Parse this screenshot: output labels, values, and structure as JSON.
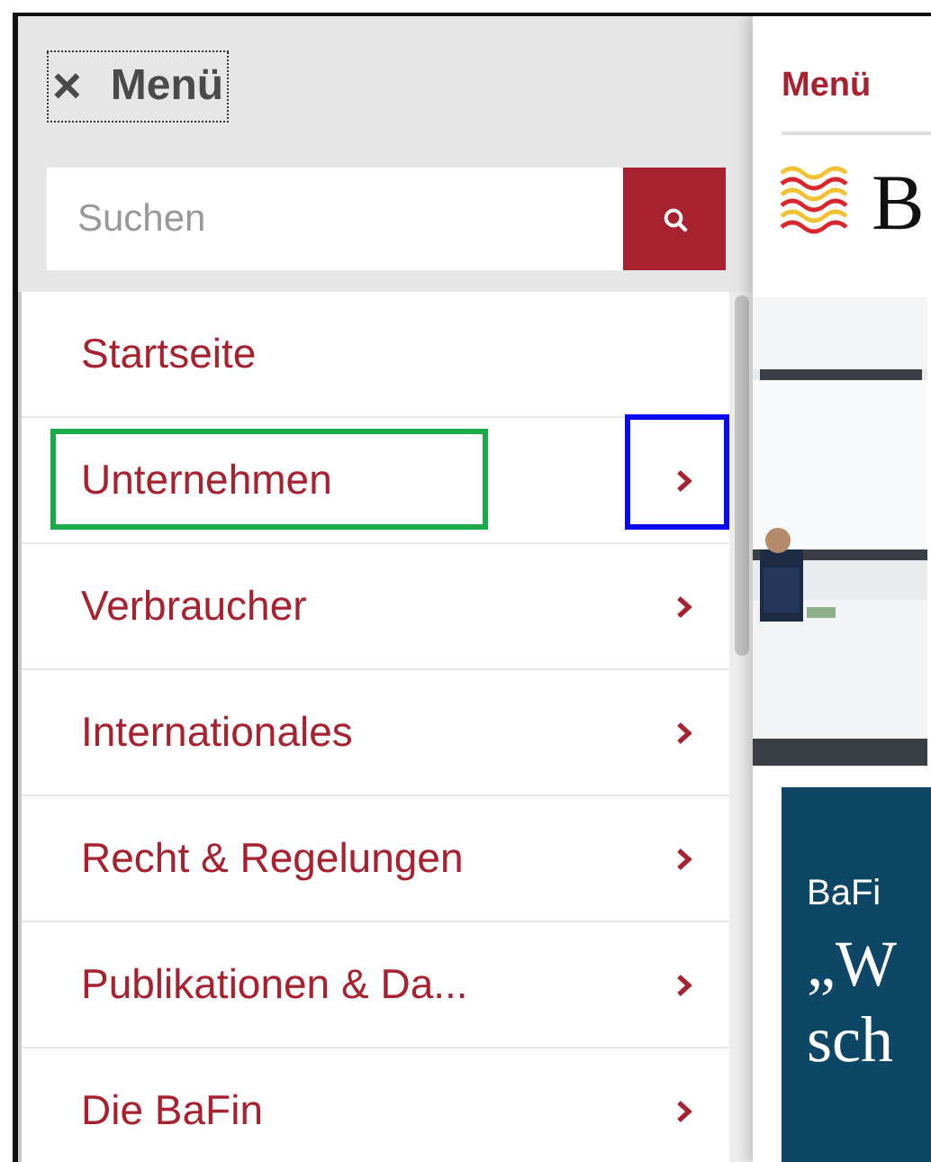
{
  "menu_panel": {
    "close_button": {
      "icon": "×",
      "label": "Menü",
      "focused": true
    },
    "search": {
      "placeholder": "Suchen"
    },
    "items": [
      {
        "label": "Startseite",
        "has_submenu": false
      },
      {
        "label": "Unternehmen",
        "has_submenu": true,
        "highlights": [
          {
            "kind": "label",
            "color": "#1aaa4a"
          },
          {
            "kind": "arrow",
            "color": "#0a0aee"
          }
        ]
      },
      {
        "label": "Verbraucher",
        "has_submenu": true
      },
      {
        "label": "Internationales",
        "has_submenu": true
      },
      {
        "label": "Recht & Regelungen",
        "has_submenu": true
      },
      {
        "label": "Publikationen & Da...",
        "has_submenu": true
      },
      {
        "label": "Die BaFin",
        "has_submenu": true
      }
    ]
  },
  "page": {
    "menu_link": "Menü",
    "logo_text": "B",
    "teaser": {
      "kicker": "BaFi",
      "headline": [
        "„W",
        "sch"
      ]
    }
  }
}
